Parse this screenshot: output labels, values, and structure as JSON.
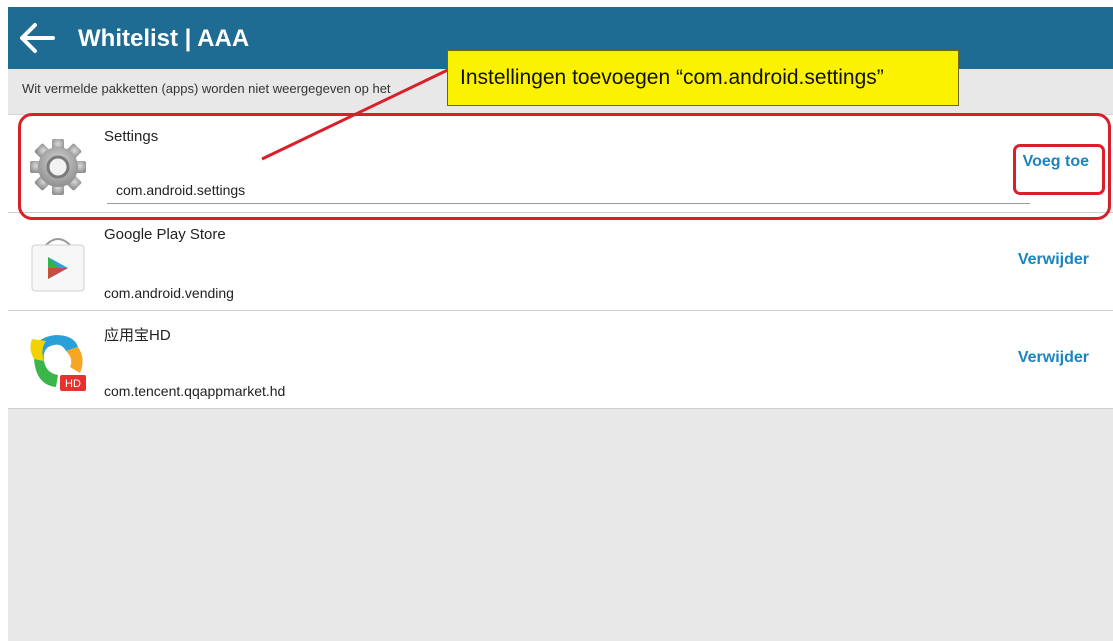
{
  "appbar": {
    "title": "Whitelist | AAA"
  },
  "subtitle": "Wit vermelde pakketten (apps) worden niet weergegeven op het",
  "rows": [
    {
      "name": "Settings",
      "package": "com.android.settings",
      "action": "Voeg toe",
      "icon": "settings-gear-icon"
    },
    {
      "name": "Google Play Store",
      "package": "com.android.vending",
      "action": "Verwijder",
      "icon": "play-store-icon"
    },
    {
      "name": "应用宝HD",
      "package": "com.tencent.qqappmarket.hd",
      "action": "Verwijder",
      "icon": "yingyongbao-icon",
      "badge": "HD"
    }
  ],
  "callout": {
    "text": "Instellingen toevoegen “com.android.settings”"
  },
  "colors": {
    "appbar": "#1e6c93",
    "action": "#1b84bf",
    "highlight": "#d9202a",
    "callout": "#fbf200"
  }
}
